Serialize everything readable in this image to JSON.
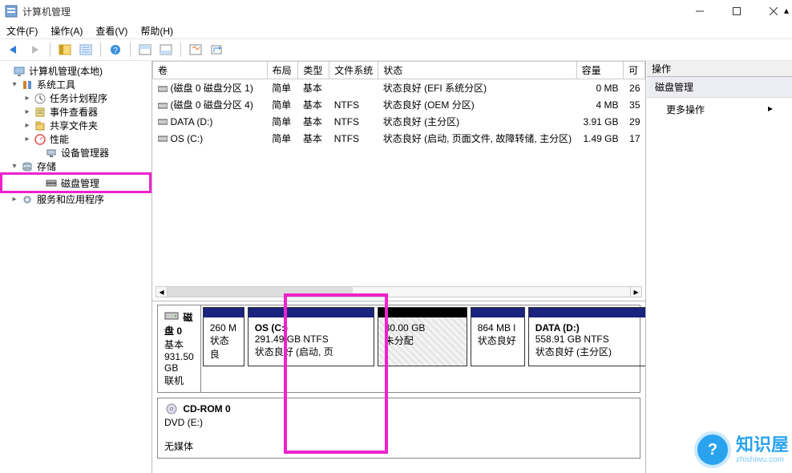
{
  "window": {
    "title": "计算机管理"
  },
  "menu": {
    "file": "文件(F)",
    "action": "操作(A)",
    "view": "查看(V)",
    "help": "帮助(H)"
  },
  "tree": {
    "root": "计算机管理(本地)",
    "system_tools": "系统工具",
    "task_scheduler": "任务计划程序",
    "event_viewer": "事件查看器",
    "shared_folders": "共享文件夹",
    "performance": "性能",
    "device_manager": "设备管理器",
    "storage": "存储",
    "disk_management": "磁盘管理",
    "services": "服务和应用程序"
  },
  "columns": {
    "vol": "卷",
    "layout": "布局",
    "type": "类型",
    "fs": "文件系统",
    "status": "状态",
    "capacity": "容量",
    "free": "可"
  },
  "vols": [
    {
      "name": "(磁盘 0 磁盘分区 1)",
      "layout": "简单",
      "type": "基本",
      "fs": "",
      "status": "状态良好 (EFI 系统分区)",
      "cap": "0 MB",
      "free": "26"
    },
    {
      "name": "(磁盘 0 磁盘分区 4)",
      "layout": "简单",
      "type": "基本",
      "fs": "NTFS",
      "status": "状态良好 (OEM 分区)",
      "cap": "4 MB",
      "free": "35"
    },
    {
      "name": "DATA (D:)",
      "layout": "简单",
      "type": "基本",
      "fs": "NTFS",
      "status": "状态良好 (主分区)",
      "cap": "3.91 GB",
      "free": "29"
    },
    {
      "name": "OS (C:)",
      "layout": "简单",
      "type": "基本",
      "fs": "NTFS",
      "status": "状态良好 (启动, 页面文件, 故障转储, 主分区)",
      "cap": "1.49 GB",
      "free": "17"
    }
  ],
  "disk0": {
    "title": "磁盘 0",
    "kind": "基本",
    "size": "931.50 GB",
    "state": "联机",
    "p1": {
      "l1": "260 M",
      "l2": "状态良"
    },
    "p2": {
      "l1": "OS  (C:)",
      "l2": "291.49 GB NTFS",
      "l3": "状态良好 (启动, 页"
    },
    "p3": {
      "l1": "80.00 GB",
      "l2": "未分配"
    },
    "p4": {
      "l1": "864 MB l",
      "l2": "状态良好"
    },
    "p5": {
      "l1": "DATA  (D:)",
      "l2": "558.91 GB NTFS",
      "l3": "状态良好 (主分区)"
    }
  },
  "cdrom": {
    "title": "CD-ROM 0",
    "drive": "DVD (E:)",
    "state": "无媒体"
  },
  "actions": {
    "header": "操作",
    "disk_mgmt": "磁盘管理",
    "more": "更多操作"
  },
  "watermark": {
    "big": "知识屋",
    "small": "zhishiwu.com",
    "bubble": "?"
  }
}
